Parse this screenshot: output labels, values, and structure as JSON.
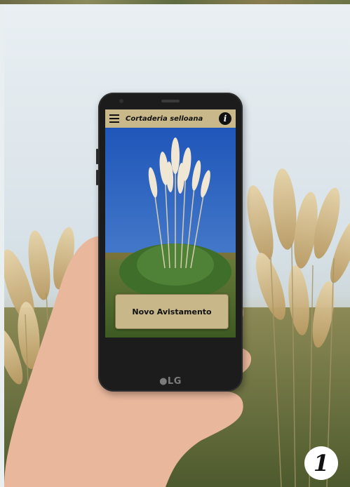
{
  "app": {
    "title": "Cortaderia selloana",
    "info_icon": "i",
    "menu_icon": "hamburger-menu-icon",
    "primary_action": "Novo Avistamento",
    "accent_color": "#c9b98a"
  },
  "device": {
    "brand": "●LG"
  },
  "step": {
    "number": "1"
  }
}
